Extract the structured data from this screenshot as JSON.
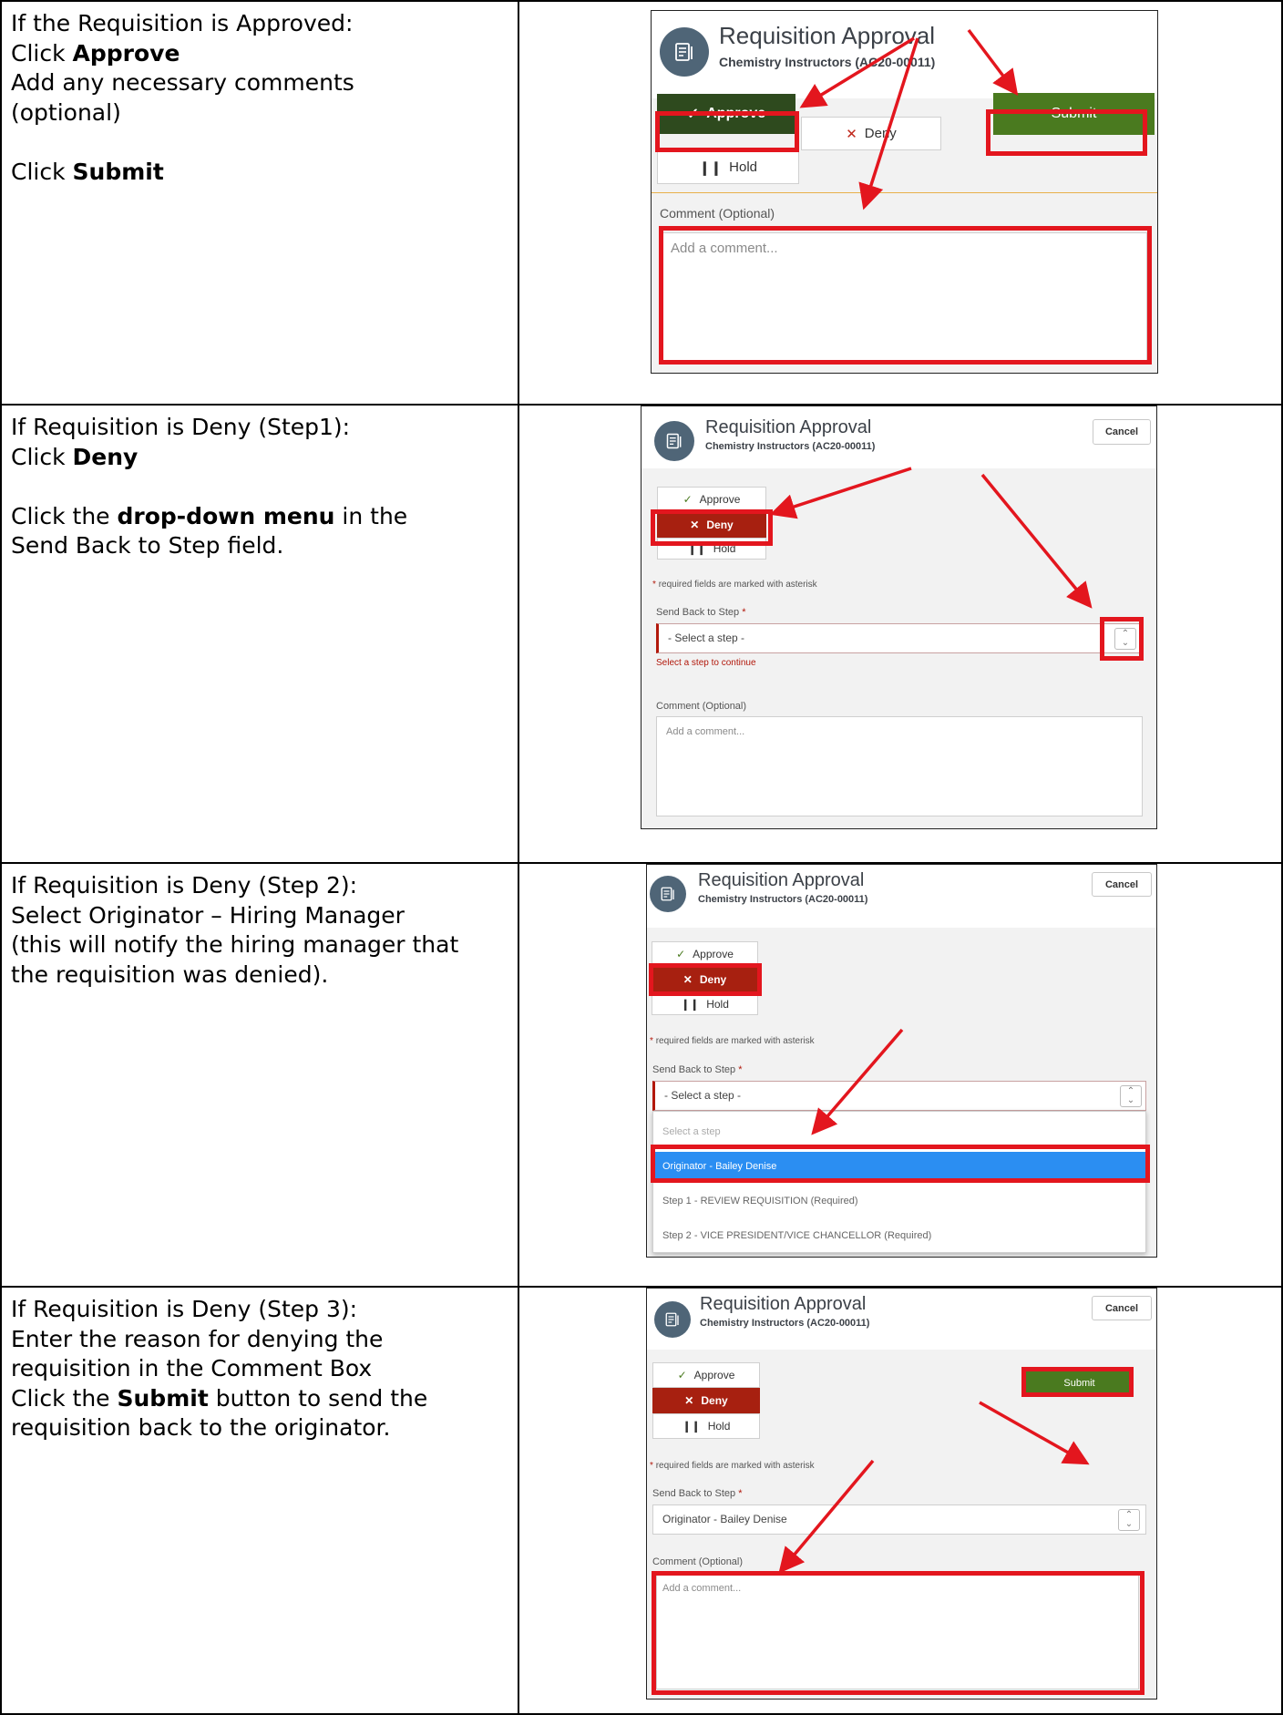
{
  "rows": [
    {
      "instruction_lines": [
        {
          "parts": [
            {
              "t": "If the Requisition is Approved:"
            }
          ]
        },
        {
          "parts": [
            {
              "t": "Click "
            },
            {
              "t": "Approve",
              "b": true
            }
          ]
        },
        {
          "parts": [
            {
              "t": "Add any necessary comments"
            }
          ]
        },
        {
          "parts": [
            {
              "t": "(optional)"
            }
          ]
        },
        {
          "parts": []
        },
        {
          "parts": [
            {
              "t": "Click "
            },
            {
              "t": "Submit",
              "b": true
            }
          ]
        }
      ]
    },
    {
      "instruction_lines": [
        {
          "parts": [
            {
              "t": "If Requisition is Deny (Step1):"
            }
          ]
        },
        {
          "parts": [
            {
              "t": "Click "
            },
            {
              "t": "Deny",
              "b": true
            }
          ]
        },
        {
          "parts": []
        },
        {
          "parts": [
            {
              "t": "Click the "
            },
            {
              "t": "drop-down menu",
              "b": true
            },
            {
              "t": " in the"
            }
          ]
        },
        {
          "parts": [
            {
              "t": "Send Back to Step field."
            }
          ]
        }
      ]
    },
    {
      "instruction_lines": [
        {
          "parts": [
            {
              "t": "If Requisition is Deny (Step 2):"
            }
          ]
        },
        {
          "parts": [
            {
              "t": "Select Originator – Hiring Manager"
            }
          ]
        },
        {
          "parts": [
            {
              "t": "(this will notify the hiring manager that"
            }
          ]
        },
        {
          "parts": [
            {
              "t": "the requisition was denied)."
            }
          ]
        }
      ]
    },
    {
      "instruction_lines": [
        {
          "parts": [
            {
              "t": "If Requisition is Deny (Step 3):"
            }
          ]
        },
        {
          "parts": [
            {
              "t": "Enter the reason for denying the"
            }
          ]
        },
        {
          "parts": [
            {
              "t": "requisition in the Comment Box"
            }
          ]
        },
        {
          "parts": [
            {
              "t": "Click the "
            },
            {
              "t": "Submit",
              "b": true
            },
            {
              "t": " button to send the"
            }
          ]
        },
        {
          "parts": [
            {
              "t": "requisition back to the originator."
            }
          ]
        }
      ]
    }
  ],
  "ui": {
    "title": "Requisition Approval",
    "subtitle": "Chemistry Instructors (AC20-00011)",
    "approve_label": "Approve",
    "deny_label": "Deny",
    "hold_label": "Hold",
    "submit_label": "Submit",
    "cancel_label": "Cancel",
    "comment_label": "Comment (Optional)",
    "comment_placeholder": "Add a comment...",
    "required_note": "required fields are marked with asterisk",
    "required_mark": "*",
    "send_back_label": "Send Back to Step",
    "select_placeholder": "- Select a step -",
    "select_error": "Select a step to continue",
    "selected_step": "Originator - Bailey Denise",
    "dropdown_options": [
      "Select a step",
      "Originator - Bailey Denise",
      "Step 1 - REVIEW REQUISITION (Required)",
      "Step 2 - VICE PRESIDENT/VICE CHANCELLOR (Required)"
    ]
  },
  "colors": {
    "highlight": "#e3161e",
    "approve_active": "#2e4a1e",
    "deny_active": "#a72010",
    "submit": "#4a7a1f",
    "dropdown_selected": "#2b8ef2",
    "icon_circle": "#4f6577"
  },
  "icons": [
    "document-icon",
    "check-icon",
    "x-icon",
    "pause-icon",
    "spinner-arrows-icon"
  ]
}
